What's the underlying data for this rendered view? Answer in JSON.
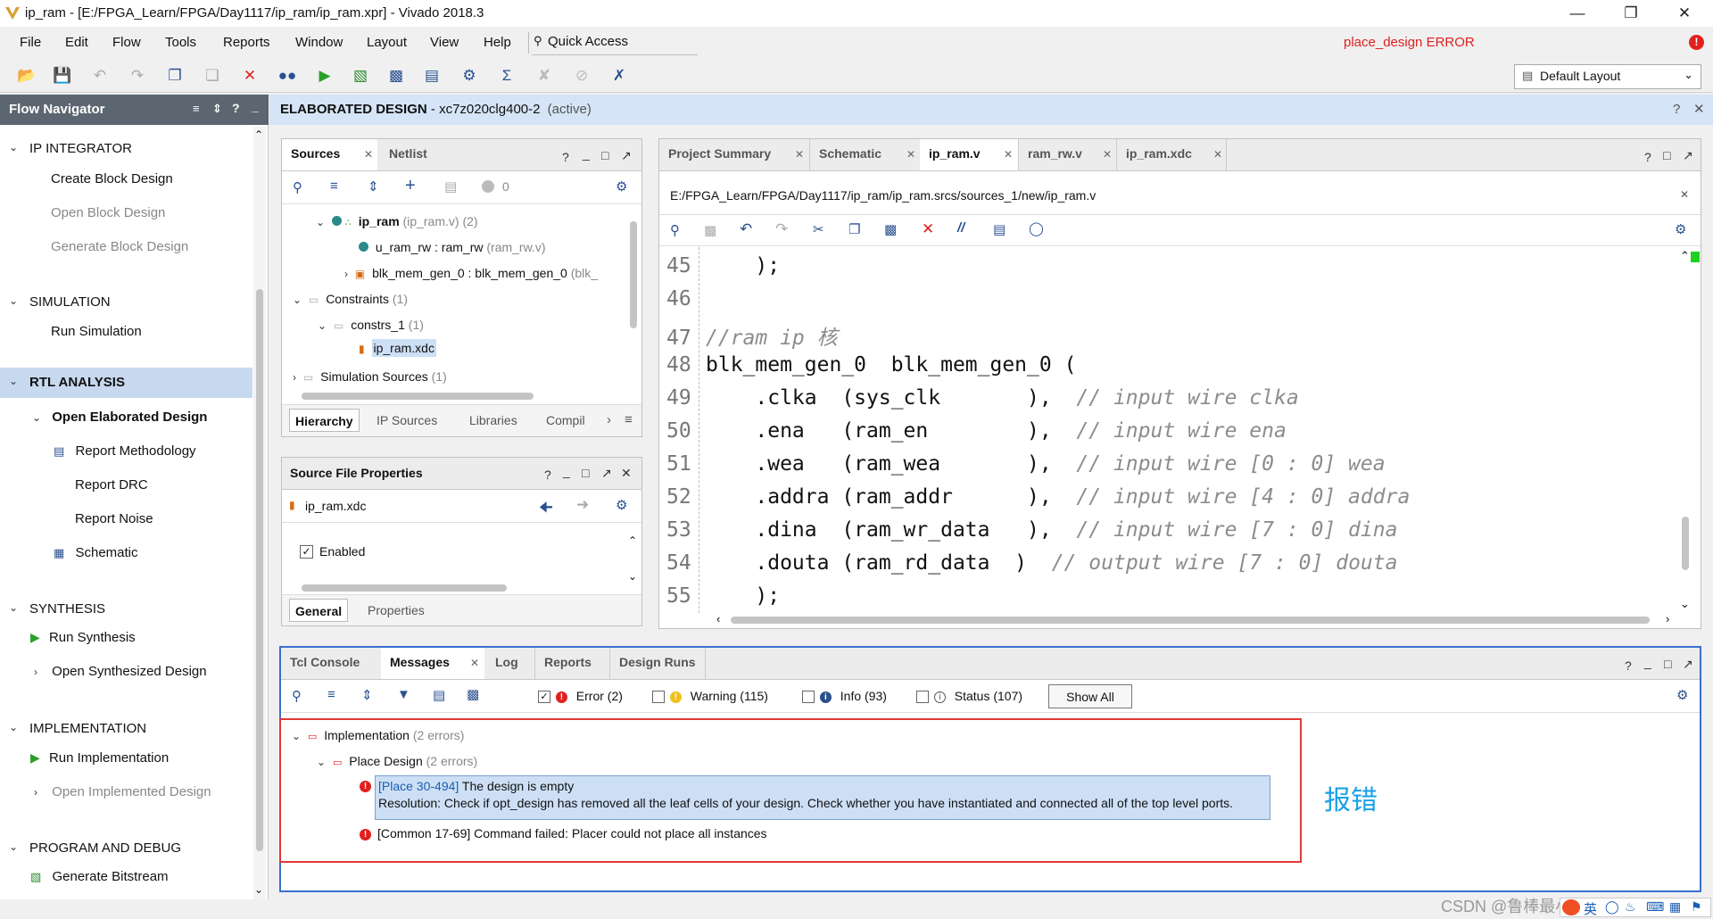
{
  "window": {
    "title": "ip_ram - [E:/FPGA_Learn/FPGA/Day1117/ip_ram/ip_ram.xpr] - Vivado 2018.3"
  },
  "menu": [
    "File",
    "Edit",
    "Flow",
    "Tools",
    "Reports",
    "Window",
    "Layout",
    "View",
    "Help"
  ],
  "quick_access": "Quick Access",
  "status_error": "place_design ERROR",
  "layout_select": "Default Layout",
  "flow_nav": {
    "title": "Flow Navigator",
    "sections": [
      {
        "label": "IP INTEGRATOR",
        "items": [
          "Create Block Design",
          "Open Block Design",
          "Generate Block Design"
        ]
      },
      {
        "label": "SIMULATION",
        "items": [
          "Run Simulation"
        ]
      },
      {
        "label": "RTL ANALYSIS",
        "sub": "Open Elaborated Design",
        "items": [
          "Report Methodology",
          "Report DRC",
          "Report Noise",
          "Schematic"
        ]
      },
      {
        "label": "SYNTHESIS",
        "items": [
          "Run Synthesis",
          "Open Synthesized Design"
        ]
      },
      {
        "label": "IMPLEMENTATION",
        "items": [
          "Run Implementation",
          "Open Implemented Design"
        ]
      },
      {
        "label": "PROGRAM AND DEBUG",
        "items": [
          "Generate Bitstream"
        ]
      }
    ]
  },
  "design_header": {
    "label": "ELABORATED DESIGN",
    "part": " - xc7z020clg400-2",
    "state": "(active)"
  },
  "sources": {
    "tabs": [
      "Sources",
      "Netlist"
    ],
    "count": "0",
    "tree": {
      "top": "ip_ram",
      "top_file": "(ip_ram.v) (2)",
      "child1": "u_ram_rw : ram_rw",
      "child1_file": "(ram_rw.v)",
      "child2": "blk_mem_gen_0 : blk_mem_gen_0",
      "child2_file": "(blk_",
      "constraints": "Constraints",
      "constraints_count": "(1)",
      "constrs": "constrs_1",
      "constrs_count": "(1)",
      "xdc": "ip_ram.xdc",
      "sim": "Simulation Sources",
      "sim_count": "(1)"
    },
    "bottom_tabs": [
      "Hierarchy",
      "IP Sources",
      "Libraries",
      "Compil"
    ]
  },
  "file_props": {
    "title": "Source File Properties",
    "file": "ip_ram.xdc",
    "enabled_label": "Enabled",
    "tabs": [
      "General",
      "Properties"
    ]
  },
  "editor": {
    "tabs": [
      "Project Summary",
      "Schematic",
      "ip_ram.v",
      "ram_rw.v",
      "ip_ram.xdc"
    ],
    "path": "E:/FPGA_Learn/FPGA/Day1117/ip_ram/ip_ram.srcs/sources_1/new/ip_ram.v",
    "lines": [
      {
        "n": "45",
        "code": "    );",
        "comment": ""
      },
      {
        "n": "46",
        "code": "",
        "comment": ""
      },
      {
        "n": "47",
        "code": "",
        "comment": "//ram ip 核"
      },
      {
        "n": "48",
        "code": "blk_mem_gen_0  blk_mem_gen_0 (",
        "comment": ""
      },
      {
        "n": "49",
        "code": "    .clka  (sys_clk       ),  ",
        "comment": "// input wire clka"
      },
      {
        "n": "50",
        "code": "    .ena   (ram_en        ),  ",
        "comment": "// input wire ena"
      },
      {
        "n": "51",
        "code": "    .wea   (ram_wea       ),  ",
        "comment": "// input wire [0 : 0] wea"
      },
      {
        "n": "52",
        "code": "    .addra (ram_addr      ),  ",
        "comment": "// input wire [4 : 0] addra"
      },
      {
        "n": "53",
        "code": "    .dina  (ram_wr_data   ),  ",
        "comment": "// input wire [7 : 0] dina"
      },
      {
        "n": "54",
        "code": "    .douta (ram_rd_data  )  ",
        "comment": "// output wire [7 : 0] douta"
      },
      {
        "n": "55",
        "code": "    );",
        "comment": ""
      }
    ]
  },
  "messages": {
    "tabs": [
      "Tcl Console",
      "Messages",
      "Log",
      "Reports",
      "Design Runs"
    ],
    "filters": [
      {
        "label": "Error (2)",
        "checked": true
      },
      {
        "label": "Warning (115)",
        "checked": false
      },
      {
        "label": "Info (93)",
        "checked": false
      },
      {
        "label": "Status (107)",
        "checked": false
      }
    ],
    "show_all": "Show All",
    "impl": "Implementation",
    "impl_count": "(2 errors)",
    "place": "Place Design",
    "place_count": "(2 errors)",
    "err1_id": "[Place 30-494]",
    "err1_text": " The design is empty",
    "err1_res": "Resolution: Check if opt_design has removed all the leaf cells of your design. Check whether you have instantiated and connected all of the top level ports.",
    "err2": "[Common 17-69] Command failed: Placer could not place all instances"
  },
  "annotation": "报错",
  "watermark": "CSDN @鲁棒最小二乘支持向量机",
  "tray": [
    "英"
  ],
  "colors": {
    "accent": "#1a5fb4",
    "error": "#e02020",
    "annotation": "#1aa0e8"
  }
}
